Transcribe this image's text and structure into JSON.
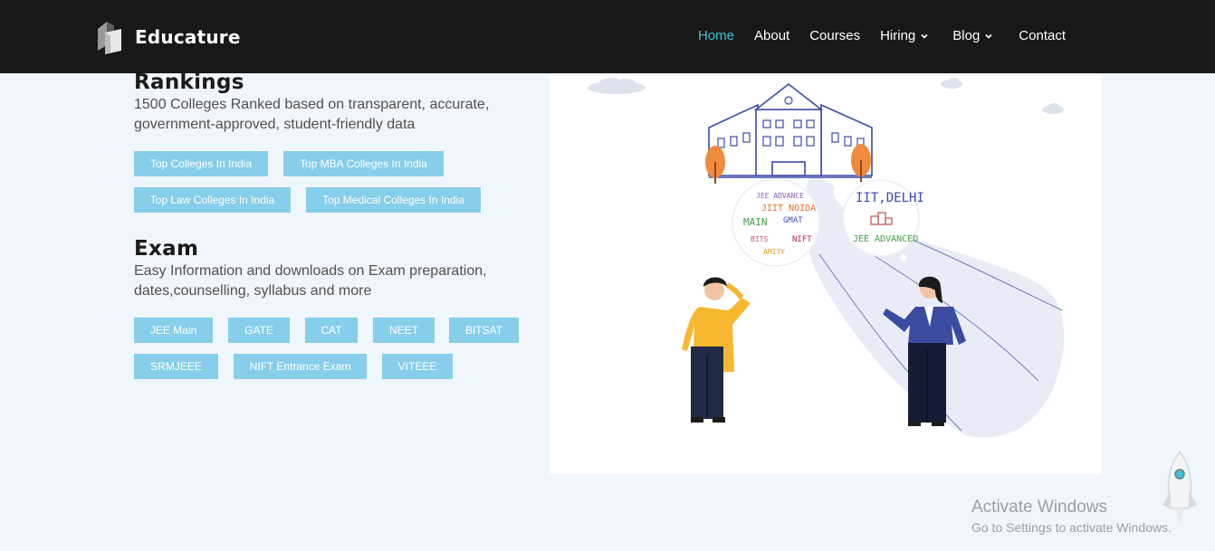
{
  "header": {
    "brand_name": "Educature",
    "nav": [
      {
        "label": "Home",
        "active": true
      },
      {
        "label": "About"
      },
      {
        "label": "Courses"
      },
      {
        "label": "Hiring",
        "dropdown": true
      },
      {
        "label": "Blog",
        "dropdown": true
      },
      {
        "label": "Contact"
      }
    ]
  },
  "rankings": {
    "title": "Rankings",
    "description": "1500 Colleges Ranked based on transparent, accurate, government-approved, student-friendly data",
    "tags": [
      "Top Colleges In India",
      "Top MBA Colleges In India",
      "Top Law Colleges In India",
      "Top Medical Colleges In India"
    ]
  },
  "exam": {
    "title": "Exam",
    "description": "Easy Information and downloads on Exam preparation, dates,counselling, syllabus and more",
    "tags": [
      "JEE Main",
      "GATE",
      "CAT",
      "NEET",
      "BITSAT",
      "SRMJEEE",
      "NIFT Entrance Exam",
      "VITEEE"
    ]
  },
  "illustration": {
    "bubble_right_line1": "IIT,DELHI",
    "bubble_right_line2": "JEE ADVANCED",
    "bubble_left_words": [
      "JEE ADVANCE",
      "JIIT NOIDA",
      "MAIN",
      "GMAT",
      "AMITY",
      "NIFT",
      "BITS"
    ]
  },
  "watermark": {
    "title": "Activate Windows",
    "subtitle": "Go to Settings to activate Windows."
  },
  "colors": {
    "accent": "#3ec4d0",
    "tag_bg": "#87ceea",
    "header_bg": "#181818",
    "page_bg": "#eff6fd"
  }
}
